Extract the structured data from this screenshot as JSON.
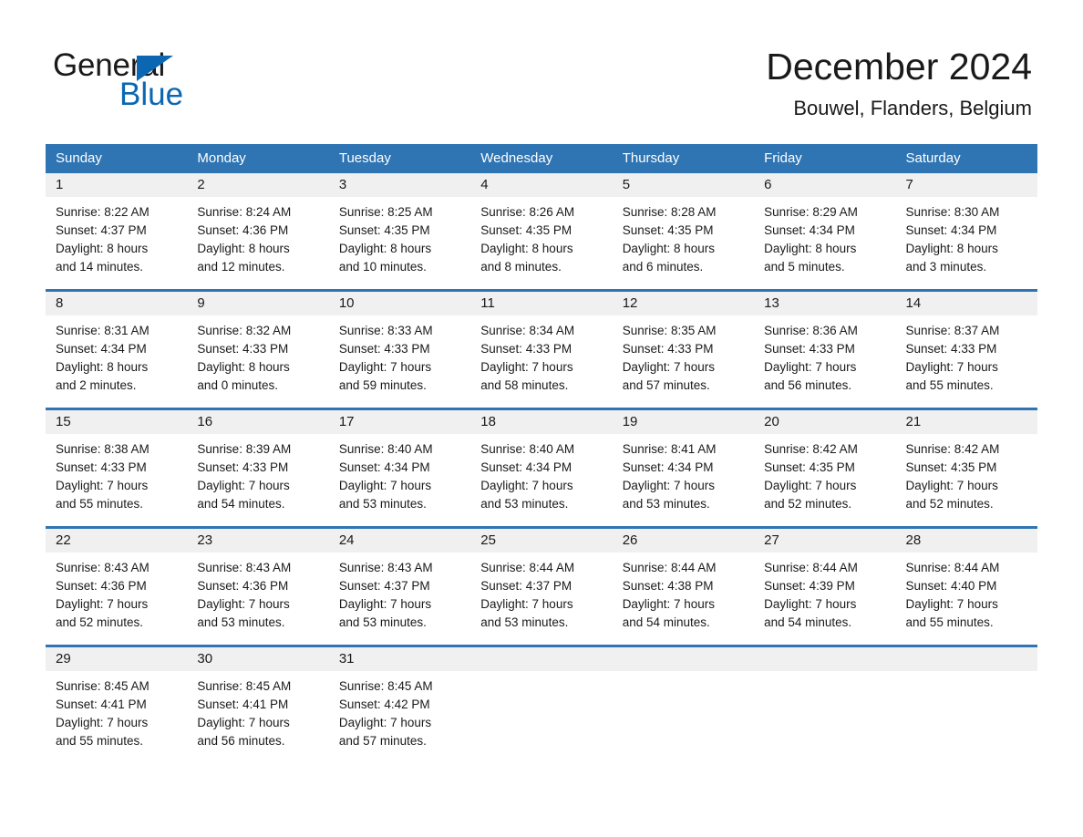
{
  "logo": {
    "word_one": "General",
    "word_two": "Blue",
    "triangle_icon": "triangle-icon",
    "accent_color": "#0b67b2"
  },
  "header": {
    "title": "December 2024",
    "subtitle": "Bouwel, Flanders, Belgium"
  },
  "theme": {
    "header_blue": "#2f74b3",
    "date_band": "#f0f0f0",
    "text": "#1a1a1a"
  },
  "weekdays": [
    "Sunday",
    "Monday",
    "Tuesday",
    "Wednesday",
    "Thursday",
    "Friday",
    "Saturday"
  ],
  "weeks": [
    [
      {
        "day": "1",
        "sunrise": "Sunrise: 8:22 AM",
        "sunset": "Sunset: 4:37 PM",
        "daylight_1": "Daylight: 8 hours",
        "daylight_2": "and 14 minutes."
      },
      {
        "day": "2",
        "sunrise": "Sunrise: 8:24 AM",
        "sunset": "Sunset: 4:36 PM",
        "daylight_1": "Daylight: 8 hours",
        "daylight_2": "and 12 minutes."
      },
      {
        "day": "3",
        "sunrise": "Sunrise: 8:25 AM",
        "sunset": "Sunset: 4:35 PM",
        "daylight_1": "Daylight: 8 hours",
        "daylight_2": "and 10 minutes."
      },
      {
        "day": "4",
        "sunrise": "Sunrise: 8:26 AM",
        "sunset": "Sunset: 4:35 PM",
        "daylight_1": "Daylight: 8 hours",
        "daylight_2": "and 8 minutes."
      },
      {
        "day": "5",
        "sunrise": "Sunrise: 8:28 AM",
        "sunset": "Sunset: 4:35 PM",
        "daylight_1": "Daylight: 8 hours",
        "daylight_2": "and 6 minutes."
      },
      {
        "day": "6",
        "sunrise": "Sunrise: 8:29 AM",
        "sunset": "Sunset: 4:34 PM",
        "daylight_1": "Daylight: 8 hours",
        "daylight_2": "and 5 minutes."
      },
      {
        "day": "7",
        "sunrise": "Sunrise: 8:30 AM",
        "sunset": "Sunset: 4:34 PM",
        "daylight_1": "Daylight: 8 hours",
        "daylight_2": "and 3 minutes."
      }
    ],
    [
      {
        "day": "8",
        "sunrise": "Sunrise: 8:31 AM",
        "sunset": "Sunset: 4:34 PM",
        "daylight_1": "Daylight: 8 hours",
        "daylight_2": "and 2 minutes."
      },
      {
        "day": "9",
        "sunrise": "Sunrise: 8:32 AM",
        "sunset": "Sunset: 4:33 PM",
        "daylight_1": "Daylight: 8 hours",
        "daylight_2": "and 0 minutes."
      },
      {
        "day": "10",
        "sunrise": "Sunrise: 8:33 AM",
        "sunset": "Sunset: 4:33 PM",
        "daylight_1": "Daylight: 7 hours",
        "daylight_2": "and 59 minutes."
      },
      {
        "day": "11",
        "sunrise": "Sunrise: 8:34 AM",
        "sunset": "Sunset: 4:33 PM",
        "daylight_1": "Daylight: 7 hours",
        "daylight_2": "and 58 minutes."
      },
      {
        "day": "12",
        "sunrise": "Sunrise: 8:35 AM",
        "sunset": "Sunset: 4:33 PM",
        "daylight_1": "Daylight: 7 hours",
        "daylight_2": "and 57 minutes."
      },
      {
        "day": "13",
        "sunrise": "Sunrise: 8:36 AM",
        "sunset": "Sunset: 4:33 PM",
        "daylight_1": "Daylight: 7 hours",
        "daylight_2": "and 56 minutes."
      },
      {
        "day": "14",
        "sunrise": "Sunrise: 8:37 AM",
        "sunset": "Sunset: 4:33 PM",
        "daylight_1": "Daylight: 7 hours",
        "daylight_2": "and 55 minutes."
      }
    ],
    [
      {
        "day": "15",
        "sunrise": "Sunrise: 8:38 AM",
        "sunset": "Sunset: 4:33 PM",
        "daylight_1": "Daylight: 7 hours",
        "daylight_2": "and 55 minutes."
      },
      {
        "day": "16",
        "sunrise": "Sunrise: 8:39 AM",
        "sunset": "Sunset: 4:33 PM",
        "daylight_1": "Daylight: 7 hours",
        "daylight_2": "and 54 minutes."
      },
      {
        "day": "17",
        "sunrise": "Sunrise: 8:40 AM",
        "sunset": "Sunset: 4:34 PM",
        "daylight_1": "Daylight: 7 hours",
        "daylight_2": "and 53 minutes."
      },
      {
        "day": "18",
        "sunrise": "Sunrise: 8:40 AM",
        "sunset": "Sunset: 4:34 PM",
        "daylight_1": "Daylight: 7 hours",
        "daylight_2": "and 53 minutes."
      },
      {
        "day": "19",
        "sunrise": "Sunrise: 8:41 AM",
        "sunset": "Sunset: 4:34 PM",
        "daylight_1": "Daylight: 7 hours",
        "daylight_2": "and 53 minutes."
      },
      {
        "day": "20",
        "sunrise": "Sunrise: 8:42 AM",
        "sunset": "Sunset: 4:35 PM",
        "daylight_1": "Daylight: 7 hours",
        "daylight_2": "and 52 minutes."
      },
      {
        "day": "21",
        "sunrise": "Sunrise: 8:42 AM",
        "sunset": "Sunset: 4:35 PM",
        "daylight_1": "Daylight: 7 hours",
        "daylight_2": "and 52 minutes."
      }
    ],
    [
      {
        "day": "22",
        "sunrise": "Sunrise: 8:43 AM",
        "sunset": "Sunset: 4:36 PM",
        "daylight_1": "Daylight: 7 hours",
        "daylight_2": "and 52 minutes."
      },
      {
        "day": "23",
        "sunrise": "Sunrise: 8:43 AM",
        "sunset": "Sunset: 4:36 PM",
        "daylight_1": "Daylight: 7 hours",
        "daylight_2": "and 53 minutes."
      },
      {
        "day": "24",
        "sunrise": "Sunrise: 8:43 AM",
        "sunset": "Sunset: 4:37 PM",
        "daylight_1": "Daylight: 7 hours",
        "daylight_2": "and 53 minutes."
      },
      {
        "day": "25",
        "sunrise": "Sunrise: 8:44 AM",
        "sunset": "Sunset: 4:37 PM",
        "daylight_1": "Daylight: 7 hours",
        "daylight_2": "and 53 minutes."
      },
      {
        "day": "26",
        "sunrise": "Sunrise: 8:44 AM",
        "sunset": "Sunset: 4:38 PM",
        "daylight_1": "Daylight: 7 hours",
        "daylight_2": "and 54 minutes."
      },
      {
        "day": "27",
        "sunrise": "Sunrise: 8:44 AM",
        "sunset": "Sunset: 4:39 PM",
        "daylight_1": "Daylight: 7 hours",
        "daylight_2": "and 54 minutes."
      },
      {
        "day": "28",
        "sunrise": "Sunrise: 8:44 AM",
        "sunset": "Sunset: 4:40 PM",
        "daylight_1": "Daylight: 7 hours",
        "daylight_2": "and 55 minutes."
      }
    ],
    [
      {
        "day": "29",
        "sunrise": "Sunrise: 8:45 AM",
        "sunset": "Sunset: 4:41 PM",
        "daylight_1": "Daylight: 7 hours",
        "daylight_2": "and 55 minutes."
      },
      {
        "day": "30",
        "sunrise": "Sunrise: 8:45 AM",
        "sunset": "Sunset: 4:41 PM",
        "daylight_1": "Daylight: 7 hours",
        "daylight_2": "and 56 minutes."
      },
      {
        "day": "31",
        "sunrise": "Sunrise: 8:45 AM",
        "sunset": "Sunset: 4:42 PM",
        "daylight_1": "Daylight: 7 hours",
        "daylight_2": "and 57 minutes."
      },
      {
        "day": "",
        "sunrise": "",
        "sunset": "",
        "daylight_1": "",
        "daylight_2": ""
      },
      {
        "day": "",
        "sunrise": "",
        "sunset": "",
        "daylight_1": "",
        "daylight_2": ""
      },
      {
        "day": "",
        "sunrise": "",
        "sunset": "",
        "daylight_1": "",
        "daylight_2": ""
      },
      {
        "day": "",
        "sunrise": "",
        "sunset": "",
        "daylight_1": "",
        "daylight_2": ""
      }
    ]
  ]
}
